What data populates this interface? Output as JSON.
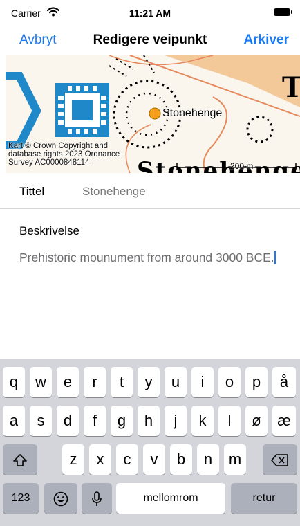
{
  "status": {
    "carrier": "Carrier",
    "time": "11:21 AM"
  },
  "nav": {
    "cancel": "Avbryt",
    "title": "Redigere veipunkt",
    "archive": "Arkiver"
  },
  "map": {
    "pin_label": "Stonehenge",
    "copyright": [
      "Kart © Crown Copyright and",
      "database rights 2023 Ordnance",
      "Survey AC0000848114"
    ],
    "scale": "200 m"
  },
  "form": {
    "title_label": "Tittel",
    "title_value": "Stonehenge",
    "description_label": "Beskrivelse",
    "description_text": "Prehistoric mounument from around 3000 BCE."
  },
  "keyboard": {
    "row1": [
      "q",
      "w",
      "e",
      "r",
      "t",
      "y",
      "u",
      "i",
      "o",
      "p",
      "å"
    ],
    "row2": [
      "a",
      "s",
      "d",
      "f",
      "g",
      "h",
      "j",
      "k",
      "l",
      "ø",
      "æ"
    ],
    "row3": [
      "z",
      "x",
      "c",
      "v",
      "b",
      "n",
      "m"
    ],
    "numbers_key": "123",
    "space_key": "mellomrom",
    "return_key": "retur"
  },
  "colors": {
    "accent": "#1b7bf5",
    "pin": "#f7a11a"
  }
}
